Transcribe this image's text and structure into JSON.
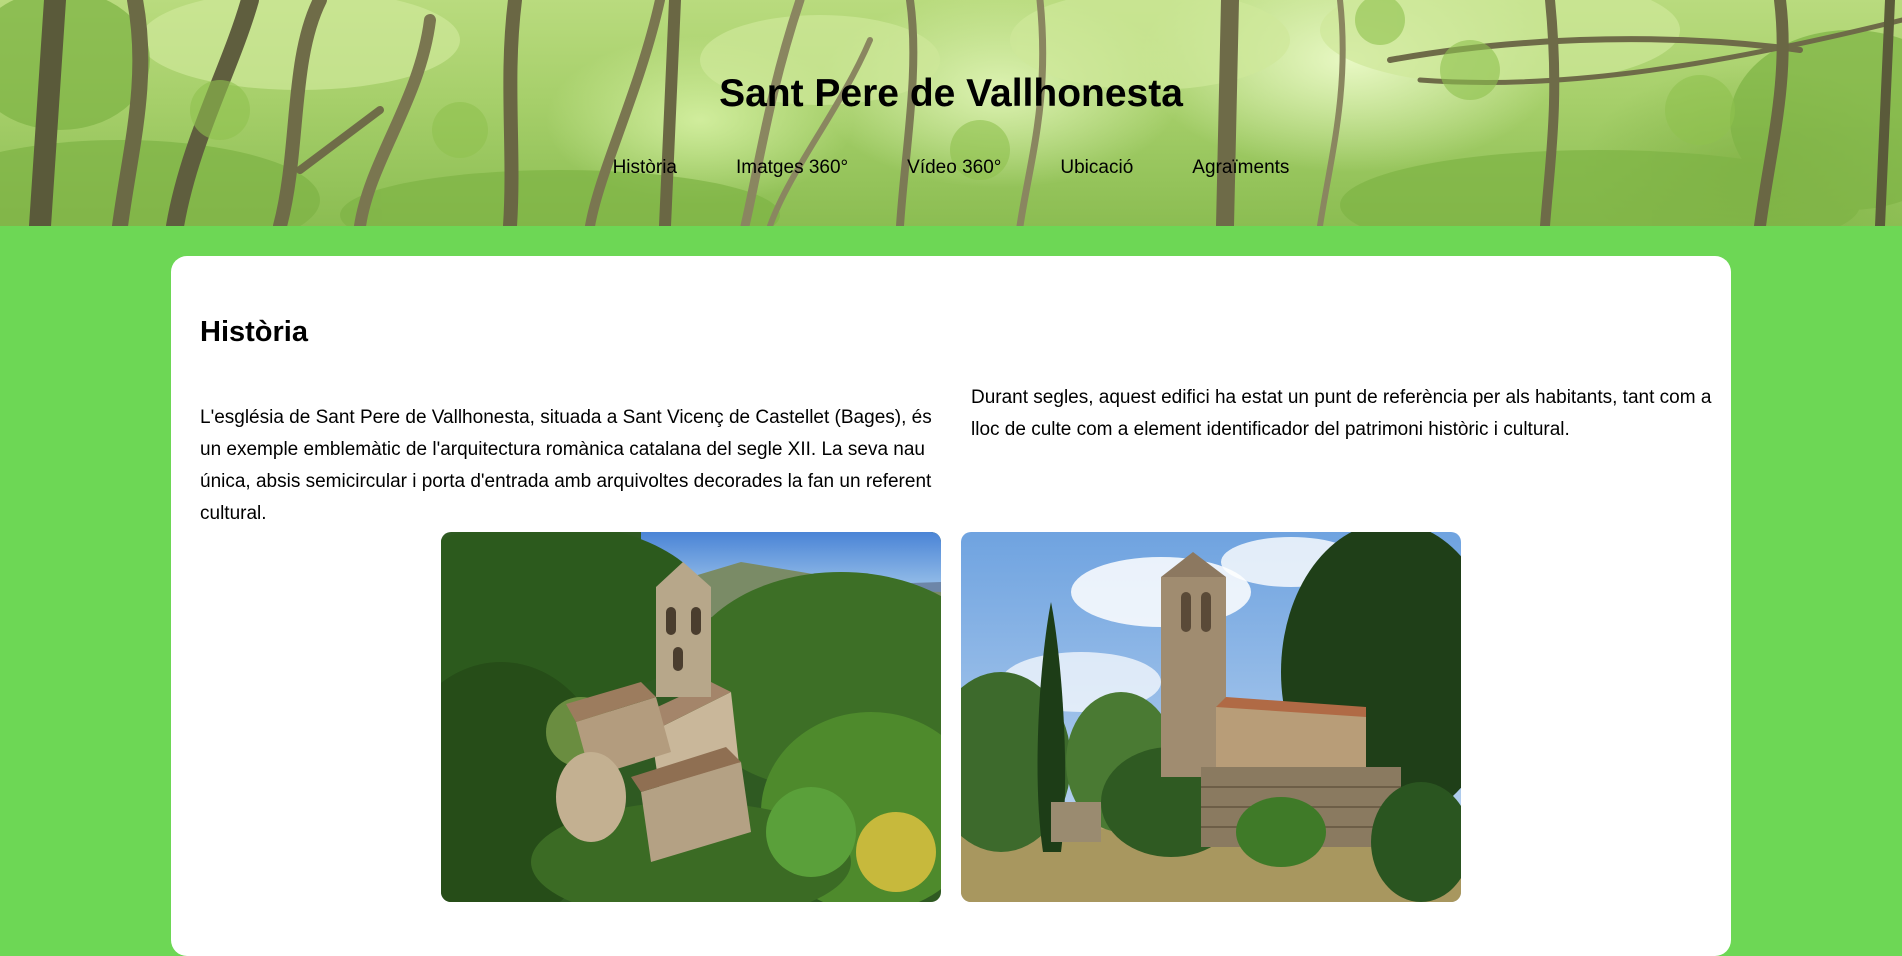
{
  "header": {
    "title": "Sant Pere de Vallhonesta",
    "nav": [
      {
        "label": "Història"
      },
      {
        "label": "Imatges 360°"
      },
      {
        "label": "Vídeo 360°"
      },
      {
        "label": "Ubicació"
      },
      {
        "label": "Agraïments"
      }
    ]
  },
  "main": {
    "heading": "Història",
    "paragraph_left": "L'església de Sant Pere de Vallhonesta, situada a Sant Vicenç de Castellet (Bages), és un exemple emblemàtic de l'arquitectura romànica catalana del segle XII. La seva nau única, absis semicircular i porta d'entrada amb arquivoltes decorades la fan un referent cultural.",
    "paragraph_right": "Durant segles, aquest edifici ha estat un punt de referència per als habitants, tant com a lloc de culte com a element identificador del patrimoni històric i cultural."
  },
  "colors": {
    "page_background": "#6dd755",
    "card_background": "#ffffff",
    "text": "#000000"
  }
}
